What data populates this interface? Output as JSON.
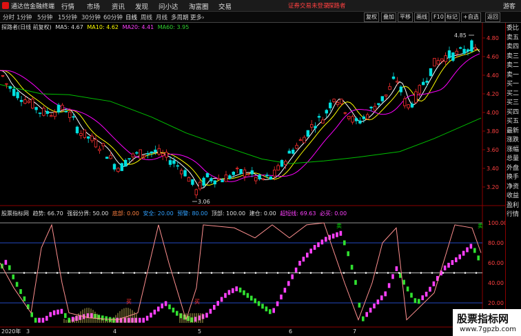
{
  "menubar": {
    "app_title": "通达信金融终端",
    "items": [
      "行情",
      "市场",
      "资讯",
      "发现",
      "问小达",
      "淘富圈",
      "交易"
    ],
    "warning": "证券交易未登录",
    "username": "探路者",
    "guest": "游客"
  },
  "toolbar": {
    "periods": [
      "分时",
      "1分钟",
      "5分钟",
      "15分钟",
      "30分钟",
      "60分钟",
      "日线",
      "周线",
      "月线",
      "多周期",
      "更多"
    ],
    "active_period": "日线",
    "more_suffix": "›",
    "buttons": [
      "复权",
      "叠加",
      "平移",
      "画线",
      "F10",
      "标记",
      "+自选",
      "返回"
    ]
  },
  "main_chart": {
    "title": "探路者(日线 前复权)",
    "ma5": "MA5: 4.67",
    "ma10": "MA10: 4.62",
    "ma20": "MA20: 4.41",
    "ma60": "MA60: 3.95",
    "high_label": "4.85",
    "low_label": "3.06",
    "price_ticks": [
      "4.80",
      "4.60",
      "4.40",
      "4.20",
      "4.00",
      "3.80",
      "3.60",
      "3.40",
      "3.20"
    ]
  },
  "indicator": {
    "name": "股票指标网",
    "trend": "趋势: 66.70",
    "divider": "强弱分界: 50.00",
    "bottom": "底部: 0.00",
    "safe": "安全: 20.00",
    "warn": "预警: 80.00",
    "top": "顶部: 100.00",
    "build": "建仓: 0.00",
    "oversold": "超短线: 69.63",
    "mustbuy": "必买: 0.00",
    "ticks": [
      "100.00",
      "80.00",
      "60.00",
      "40.00",
      "20.00"
    ],
    "buy_marker": "买",
    "sell_marker": "卖"
  },
  "x_axis": {
    "year": "2020年",
    "months": [
      "3",
      "4",
      "5",
      "6",
      "7"
    ]
  },
  "right_panel": [
    "委比",
    "卖五",
    "卖四",
    "卖三",
    "卖二",
    "卖一",
    "买一",
    "买二",
    "买三",
    "买四",
    "买五",
    "最新",
    "涨跌",
    "涨幅",
    "总量",
    "外盘",
    "换手",
    "净资",
    "收益",
    "盈利",
    "行情"
  ],
  "watermark": {
    "title": "股票指标网",
    "url": "www.7gpzb.com"
  },
  "colors": {
    "up": "#ff3030",
    "down": "#00e0e0",
    "ma5": "#ffffff",
    "ma10": "#ffff00",
    "ma20": "#ff00ff",
    "ma60": "#00c000",
    "bg": "#000000"
  }
}
